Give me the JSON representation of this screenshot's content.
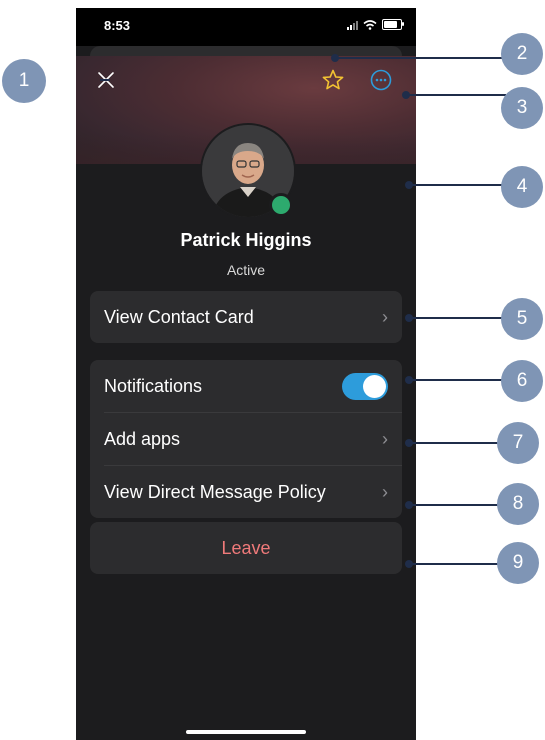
{
  "status_bar": {
    "time": "8:53"
  },
  "header": {
    "close_icon": "close-icon",
    "favorite_icon": "star-icon",
    "more_icon": "more-options-icon",
    "favorite_color": "#f2c232",
    "more_color": "#2d9cdb"
  },
  "profile": {
    "name": "Patrick Higgins",
    "status": "Active",
    "presence_color": "#2daa6e"
  },
  "contact_card": {
    "label": "View Contact Card"
  },
  "settings": {
    "notifications_label": "Notifications",
    "notifications_on": true,
    "add_apps_label": "Add apps",
    "dm_policy_label": "View Direct Message Policy"
  },
  "leave": {
    "label": "Leave",
    "color": "#f07a7a"
  },
  "callouts": [
    "1",
    "2",
    "3",
    "4",
    "5",
    "6",
    "7",
    "8",
    "9"
  ]
}
